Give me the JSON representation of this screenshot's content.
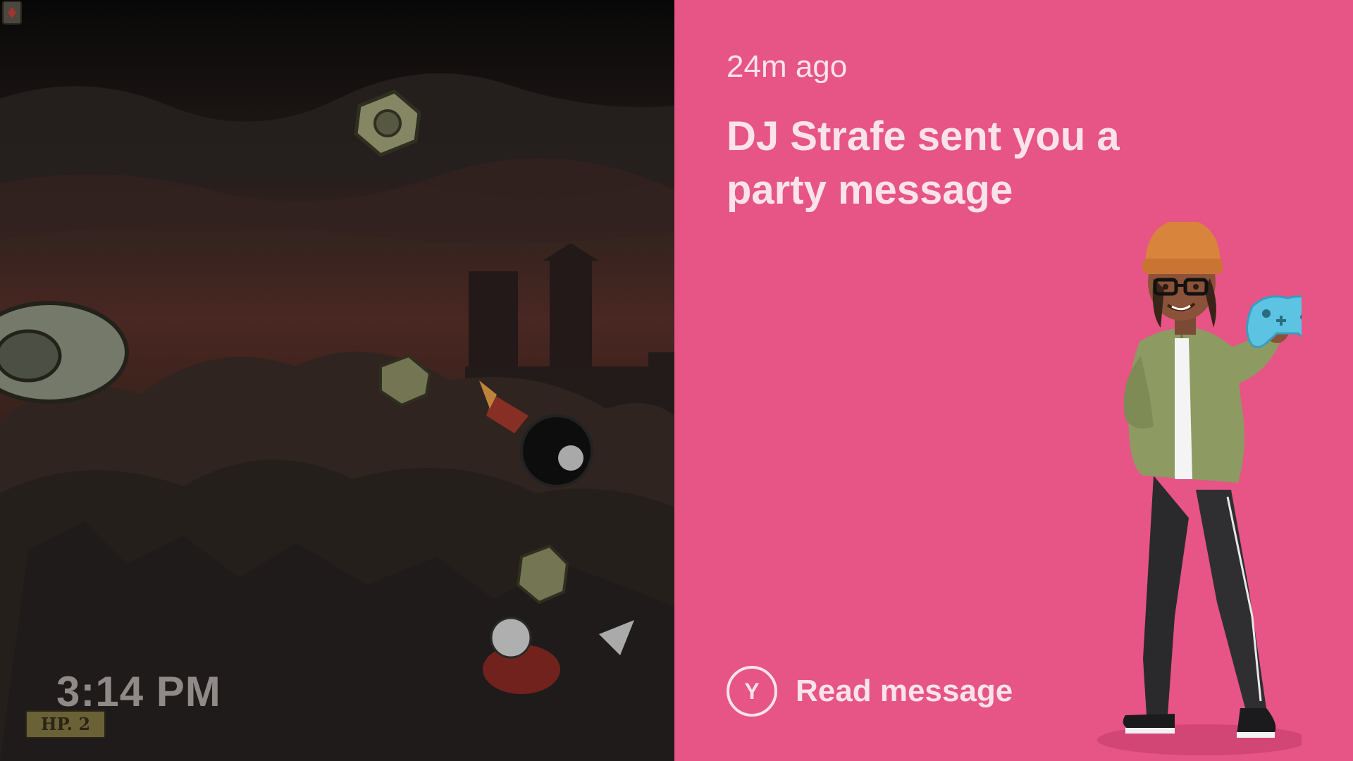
{
  "game": {
    "clock": "3:14 PM",
    "hp_label": "HP. 2"
  },
  "notification": {
    "timestamp": "24m ago",
    "title": "DJ Strafe sent you a party message",
    "action_button": "Y",
    "action_label": "Read message",
    "avatar_icon": "xbox-avatar-holding-controller",
    "background_color": "#e75486"
  }
}
